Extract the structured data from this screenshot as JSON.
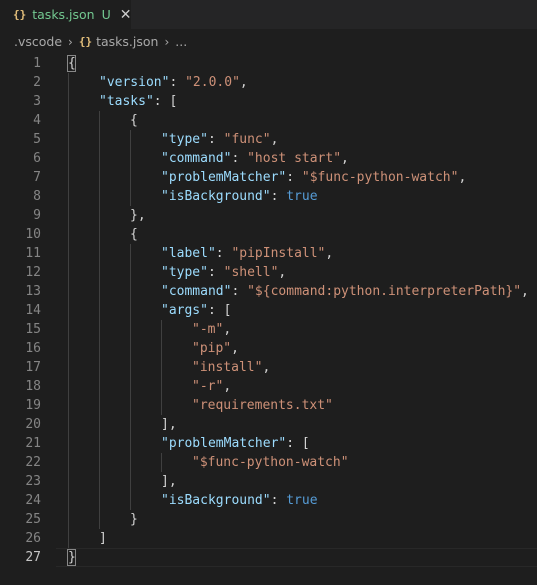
{
  "tab": {
    "icon": "{}",
    "icon_name": "json-braces-icon",
    "label": "tasks.json",
    "status": "U",
    "close": "✕"
  },
  "breadcrumb": {
    "folder": ".vscode",
    "file_icon": "{}",
    "file": "tasks.json",
    "more": "...",
    "separator": "›"
  },
  "editor": {
    "active_line": 27,
    "lines": [
      {
        "n": "1",
        "indent": 0,
        "tokens": [
          {
            "t": "p",
            "v": "{"
          }
        ]
      },
      {
        "n": "2",
        "indent": 1,
        "tokens": [
          {
            "t": "k",
            "v": "\"version\""
          },
          {
            "t": "p",
            "v": ": "
          },
          {
            "t": "s",
            "v": "\"2.0.0\""
          },
          {
            "t": "p",
            "v": ","
          }
        ]
      },
      {
        "n": "3",
        "indent": 1,
        "tokens": [
          {
            "t": "k",
            "v": "\"tasks\""
          },
          {
            "t": "p",
            "v": ": ["
          }
        ]
      },
      {
        "n": "4",
        "indent": 2,
        "tokens": [
          {
            "t": "p",
            "v": "{"
          }
        ]
      },
      {
        "n": "5",
        "indent": 3,
        "tokens": [
          {
            "t": "k",
            "v": "\"type\""
          },
          {
            "t": "p",
            "v": ": "
          },
          {
            "t": "s",
            "v": "\"func\""
          },
          {
            "t": "p",
            "v": ","
          }
        ]
      },
      {
        "n": "6",
        "indent": 3,
        "tokens": [
          {
            "t": "k",
            "v": "\"command\""
          },
          {
            "t": "p",
            "v": ": "
          },
          {
            "t": "s",
            "v": "\"host start\""
          },
          {
            "t": "p",
            "v": ","
          }
        ]
      },
      {
        "n": "7",
        "indent": 3,
        "tokens": [
          {
            "t": "k",
            "v": "\"problemMatcher\""
          },
          {
            "t": "p",
            "v": ": "
          },
          {
            "t": "s",
            "v": "\"$func-python-watch\""
          },
          {
            "t": "p",
            "v": ","
          }
        ]
      },
      {
        "n": "8",
        "indent": 3,
        "tokens": [
          {
            "t": "k",
            "v": "\"isBackground\""
          },
          {
            "t": "p",
            "v": ": "
          },
          {
            "t": "b",
            "v": "true"
          }
        ]
      },
      {
        "n": "9",
        "indent": 2,
        "tokens": [
          {
            "t": "p",
            "v": "},"
          }
        ]
      },
      {
        "n": "10",
        "indent": 2,
        "tokens": [
          {
            "t": "p",
            "v": "{"
          }
        ]
      },
      {
        "n": "11",
        "indent": 3,
        "tokens": [
          {
            "t": "k",
            "v": "\"label\""
          },
          {
            "t": "p",
            "v": ": "
          },
          {
            "t": "s",
            "v": "\"pipInstall\""
          },
          {
            "t": "p",
            "v": ","
          }
        ]
      },
      {
        "n": "12",
        "indent": 3,
        "tokens": [
          {
            "t": "k",
            "v": "\"type\""
          },
          {
            "t": "p",
            "v": ": "
          },
          {
            "t": "s",
            "v": "\"shell\""
          },
          {
            "t": "p",
            "v": ","
          }
        ]
      },
      {
        "n": "13",
        "indent": 3,
        "tokens": [
          {
            "t": "k",
            "v": "\"command\""
          },
          {
            "t": "p",
            "v": ": "
          },
          {
            "t": "s",
            "v": "\"${command:python.interpreterPath}\""
          },
          {
            "t": "p",
            "v": ","
          }
        ]
      },
      {
        "n": "14",
        "indent": 3,
        "tokens": [
          {
            "t": "k",
            "v": "\"args\""
          },
          {
            "t": "p",
            "v": ": ["
          }
        ]
      },
      {
        "n": "15",
        "indent": 4,
        "tokens": [
          {
            "t": "s",
            "v": "\"-m\""
          },
          {
            "t": "p",
            "v": ","
          }
        ]
      },
      {
        "n": "16",
        "indent": 4,
        "tokens": [
          {
            "t": "s",
            "v": "\"pip\""
          },
          {
            "t": "p",
            "v": ","
          }
        ]
      },
      {
        "n": "17",
        "indent": 4,
        "tokens": [
          {
            "t": "s",
            "v": "\"install\""
          },
          {
            "t": "p",
            "v": ","
          }
        ]
      },
      {
        "n": "18",
        "indent": 4,
        "tokens": [
          {
            "t": "s",
            "v": "\"-r\""
          },
          {
            "t": "p",
            "v": ","
          }
        ]
      },
      {
        "n": "19",
        "indent": 4,
        "tokens": [
          {
            "t": "s",
            "v": "\"requirements.txt\""
          }
        ]
      },
      {
        "n": "20",
        "indent": 3,
        "tokens": [
          {
            "t": "p",
            "v": "],"
          }
        ]
      },
      {
        "n": "21",
        "indent": 3,
        "tokens": [
          {
            "t": "k",
            "v": "\"problemMatcher\""
          },
          {
            "t": "p",
            "v": ": ["
          }
        ]
      },
      {
        "n": "22",
        "indent": 4,
        "tokens": [
          {
            "t": "s",
            "v": "\"$func-python-watch\""
          }
        ]
      },
      {
        "n": "23",
        "indent": 3,
        "tokens": [
          {
            "t": "p",
            "v": "],"
          }
        ]
      },
      {
        "n": "24",
        "indent": 3,
        "tokens": [
          {
            "t": "k",
            "v": "\"isBackground\""
          },
          {
            "t": "p",
            "v": ": "
          },
          {
            "t": "b",
            "v": "true"
          }
        ]
      },
      {
        "n": "25",
        "indent": 2,
        "tokens": [
          {
            "t": "p",
            "v": "}"
          }
        ]
      },
      {
        "n": "26",
        "indent": 1,
        "tokens": [
          {
            "t": "p",
            "v": "]"
          }
        ]
      },
      {
        "n": "27",
        "indent": 0,
        "tokens": [
          {
            "t": "p",
            "v": "}"
          }
        ]
      }
    ]
  },
  "colors": {
    "background": "#1e1e1e",
    "key": "#9cdcfe",
    "string": "#ce9178",
    "boolean": "#569cd6",
    "punctuation": "#d4d4d4",
    "untracked": "#73c991",
    "json_icon": "#e5c07b"
  }
}
